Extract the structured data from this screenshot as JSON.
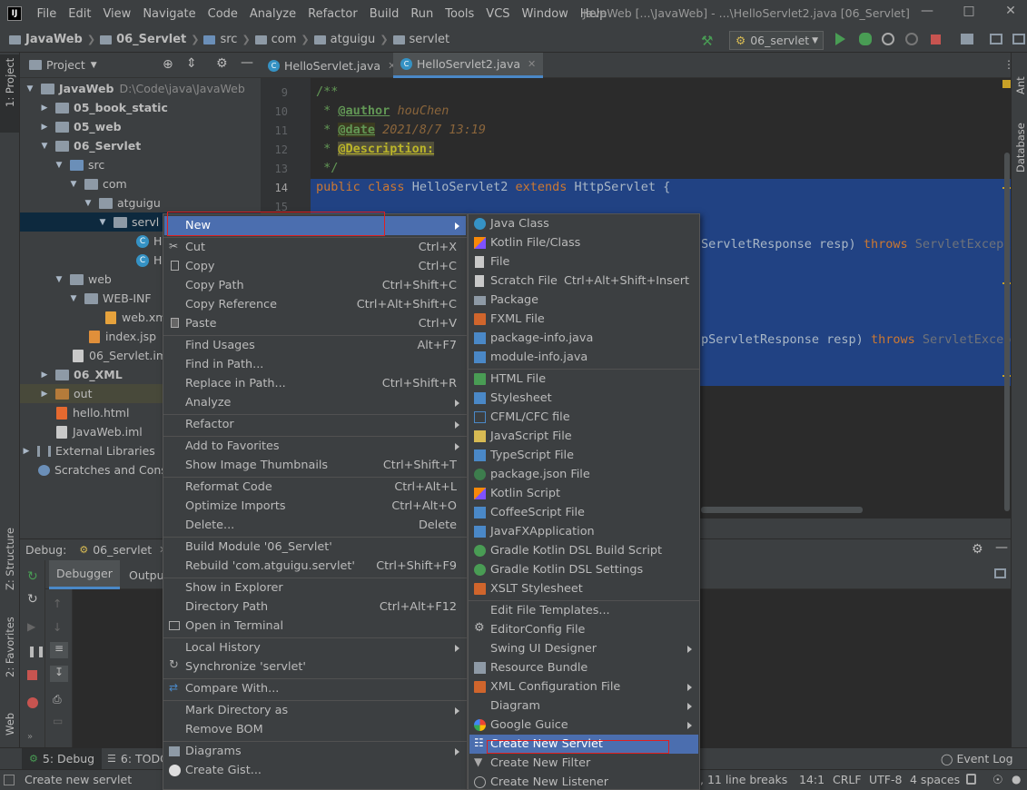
{
  "window": {
    "title": "JavaWeb [...\\JavaWeb] - ...\\HelloServlet2.java [06_Servlet]",
    "menus": [
      "File",
      "Edit",
      "View",
      "Navigate",
      "Code",
      "Analyze",
      "Refactor",
      "Build",
      "Run",
      "Tools",
      "VCS",
      "Window",
      "Help"
    ]
  },
  "breadcrumb": [
    "JavaWeb",
    "06_Servlet",
    "src",
    "com",
    "atguigu",
    "servlet"
  ],
  "run_config": "06_servlet",
  "left_strip": {
    "project": "1: Project",
    "structure": "Z: Structure",
    "favorites": "2: Favorites",
    "web": "Web"
  },
  "right_strip": {
    "ant": "Ant",
    "database": "Database"
  },
  "project_panel": {
    "title": "Project",
    "tree": [
      {
        "label": "JavaWeb",
        "path": "D:\\Code\\java\\JavaWeb"
      },
      {
        "label": "05_book_static"
      },
      {
        "label": "05_web"
      },
      {
        "label": "06_Servlet"
      },
      {
        "label": "src"
      },
      {
        "label": "com"
      },
      {
        "label": "atguigu"
      },
      {
        "label": "servl"
      },
      {
        "label": "H"
      },
      {
        "label": "H"
      },
      {
        "label": "web"
      },
      {
        "label": "WEB-INF"
      },
      {
        "label": "web.xml"
      },
      {
        "label": "index.jsp"
      },
      {
        "label": "06_Servlet.iml"
      },
      {
        "label": "06_XML"
      },
      {
        "label": "out"
      },
      {
        "label": "hello.html"
      },
      {
        "label": "JavaWeb.iml"
      },
      {
        "label": "External Libraries"
      },
      {
        "label": "Scratches and Conso"
      }
    ]
  },
  "editor": {
    "tabs": [
      "HelloServlet.java",
      "HelloServlet2.java"
    ],
    "line_numbers": [
      "9",
      "10",
      "11",
      "12",
      "13",
      "14",
      "15"
    ],
    "code": {
      "l9": "/**",
      "l10_tag": "@author",
      "l10_val": "houChen",
      "l11_tag": "@date",
      "l11_val": "2021/8/7 13:19",
      "l12_tag": "@Description:",
      "l13": "*/",
      "l14_kw1": "public class",
      "l14_name": "HelloServlet2",
      "l14_kw2": "extends",
      "l14_type": "HttpServlet",
      "l14_brace": "{",
      "frag1_a": "ServletResponse resp)",
      "frag1_kw": "throws",
      "frag1_b": "ServletExcepti",
      "frag2_a": "pServletResponse resp)",
      "frag2_kw": "throws",
      "frag2_b": "ServletExcept"
    }
  },
  "debug": {
    "label": "Debug:",
    "config": "06_servlet",
    "tabs": [
      "Debugger",
      "Output"
    ]
  },
  "bottom_tools": {
    "debug": "5: Debug",
    "todo": "6: TODO",
    "event_log": "Event Log"
  },
  "status": {
    "message": "Create new servlet",
    "line_breaks": ", 11 line breaks",
    "position": "14:1",
    "line_sep": "CRLF",
    "encoding": "UTF-8",
    "indent": "4 spaces"
  },
  "context_menu": {
    "new": "New",
    "cut": {
      "label": "Cut",
      "shortcut": "Ctrl+X"
    },
    "copy": {
      "label": "Copy",
      "shortcut": "Ctrl+C"
    },
    "copy_path": {
      "label": "Copy Path",
      "shortcut": "Ctrl+Shift+C"
    },
    "copy_reference": {
      "label": "Copy Reference",
      "shortcut": "Ctrl+Alt+Shift+C"
    },
    "paste": {
      "label": "Paste",
      "shortcut": "Ctrl+V"
    },
    "find_usages": {
      "label": "Find Usages",
      "shortcut": "Alt+F7"
    },
    "find_in_path": {
      "label": "Find in Path..."
    },
    "replace_in_path": {
      "label": "Replace in Path...",
      "shortcut": "Ctrl+Shift+R"
    },
    "analyze": {
      "label": "Analyze"
    },
    "refactor": {
      "label": "Refactor"
    },
    "add_to_favorites": {
      "label": "Add to Favorites"
    },
    "show_thumbnails": {
      "label": "Show Image Thumbnails",
      "shortcut": "Ctrl+Shift+T"
    },
    "reformat": {
      "label": "Reformat Code",
      "shortcut": "Ctrl+Alt+L"
    },
    "optimize_imports": {
      "label": "Optimize Imports",
      "shortcut": "Ctrl+Alt+O"
    },
    "delete": {
      "label": "Delete...",
      "shortcut": "Delete"
    },
    "build_module": {
      "label": "Build Module '06_Servlet'"
    },
    "rebuild": {
      "label": "Rebuild 'com.atguigu.servlet'",
      "shortcut": "Ctrl+Shift+F9"
    },
    "show_explorer": {
      "label": "Show in Explorer"
    },
    "directory_path": {
      "label": "Directory Path",
      "shortcut": "Ctrl+Alt+F12"
    },
    "open_terminal": {
      "label": "Open in Terminal"
    },
    "local_history": {
      "label": "Local History"
    },
    "synchronize": {
      "label": "Synchronize 'servlet'"
    },
    "compare_with": {
      "label": "Compare With..."
    },
    "mark_directory": {
      "label": "Mark Directory as"
    },
    "remove_bom": {
      "label": "Remove BOM"
    },
    "diagrams": {
      "label": "Diagrams"
    },
    "create_gist": {
      "label": "Create Gist..."
    }
  },
  "submenu_new": {
    "java_class": "Java Class",
    "kotlin_file": "Kotlin File/Class",
    "file": "File",
    "scratch_file": {
      "label": "Scratch File",
      "shortcut": "Ctrl+Alt+Shift+Insert"
    },
    "package": "Package",
    "fxml_file": "FXML File",
    "package_info": "package-info.java",
    "module_info": "module-info.java",
    "html_file": "HTML File",
    "stylesheet": "Stylesheet",
    "cfml_file": "CFML/CFC file",
    "javascript_file": "JavaScript File",
    "typescript_file": "TypeScript File",
    "package_json": "package.json File",
    "kotlin_script": "Kotlin Script",
    "coffeescript": "CoffeeScript File",
    "javafx": "JavaFXApplication",
    "gradle_build": "Gradle Kotlin DSL Build Script",
    "gradle_settings": "Gradle Kotlin DSL Settings",
    "xslt": "XSLT Stylesheet",
    "edit_templates": "Edit File Templates...",
    "editorconfig": "EditorConfig File",
    "swing_designer": "Swing UI Designer",
    "resource_bundle": "Resource Bundle",
    "xml_config": "XML Configuration File",
    "diagram": "Diagram",
    "google_guice": "Google Guice",
    "create_servlet": "Create New Servlet",
    "create_filter": "Create New Filter",
    "create_listener": "Create New Listener"
  },
  "colors": {
    "accent": "#4b6eaf",
    "selection": "#214283",
    "highlight_box": "#e02020"
  }
}
